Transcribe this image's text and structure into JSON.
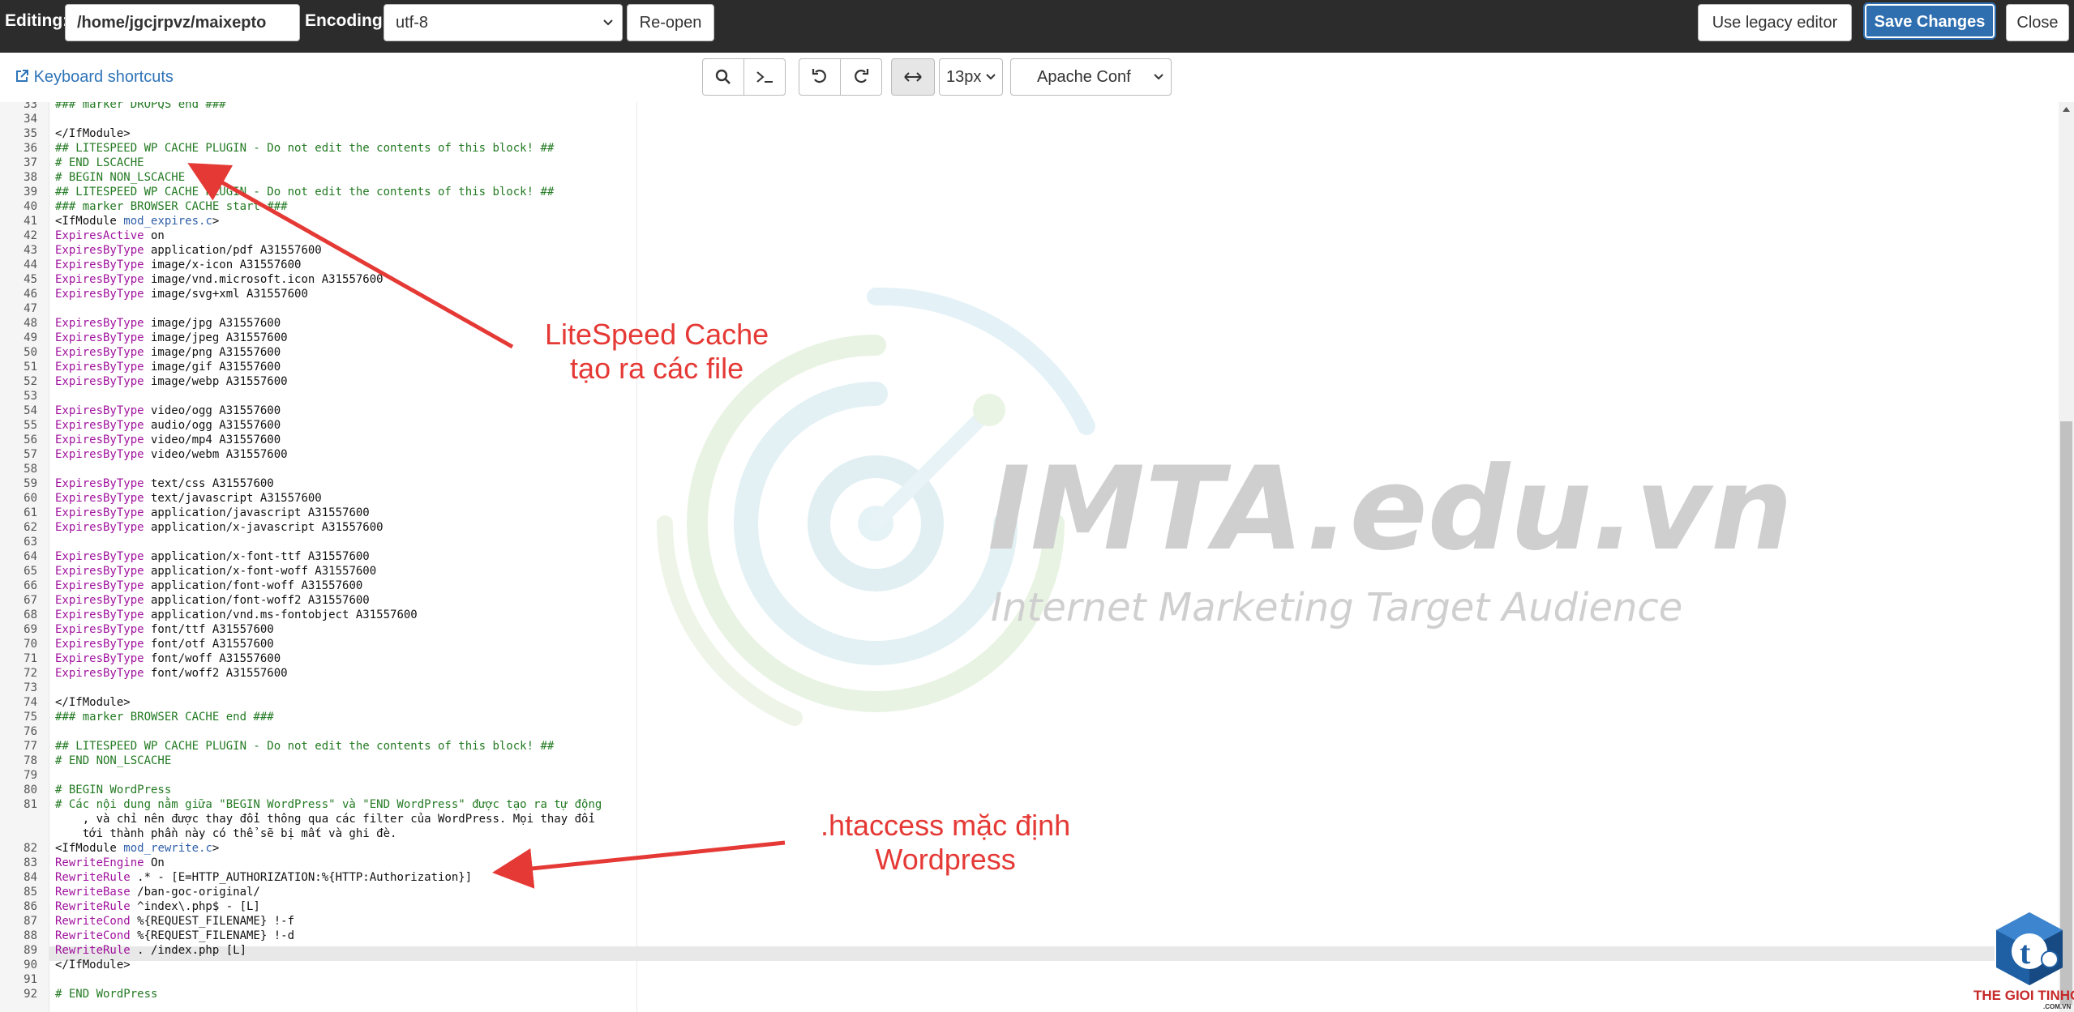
{
  "header": {
    "editing_label": "Editing:",
    "file_path": "/home/jgcjrpvz/maixepto",
    "encoding_label": "Encoding:",
    "encoding_value": "utf-8",
    "reopen_label": "Re-open",
    "legacy_label": "Use legacy editor",
    "save_label": "Save Changes",
    "close_label": "Close"
  },
  "toolbar": {
    "shortcuts_label": "Keyboard shortcuts",
    "font_size": "13px",
    "mode": "Apache Conf"
  },
  "icons": [
    "search-icon",
    "terminal-icon",
    "undo-icon",
    "redo-icon",
    "wrap-icon",
    "external-link-icon",
    "chevron-down-icon"
  ],
  "colors": {
    "accent": "#2f6fb0",
    "annotation": "#e53935",
    "comment": "#237a23",
    "keyword": "#a0129e",
    "module": "#2f5fa8"
  },
  "watermark": {
    "brand": "IMTA.edu.vn",
    "tagline": "Internet Marketing Target Audience"
  },
  "annotations": {
    "litespeed_line1": "LiteSpeed Cache",
    "litespeed_line2": "tạo ra các file",
    "htaccess_line1": ".htaccess mặc định",
    "htaccess_line2": "Wordpress"
  },
  "logo": {
    "brand": "THE GIOI TINHOC",
    "domain": ".COM.VN",
    "letter": "t"
  },
  "editor": {
    "active_line": "89",
    "lines": [
      {
        "n": "33",
        "t": "### marker DROPQS end ###"
      },
      {
        "n": "34",
        "t": ""
      },
      {
        "n": "35",
        "t": "</IfModule>"
      },
      {
        "n": "36",
        "t": "## LITESPEED WP CACHE PLUGIN - Do not edit the contents of this block! ##"
      },
      {
        "n": "37",
        "t": "# END LSCACHE"
      },
      {
        "n": "38",
        "t": "# BEGIN NON_LSCACHE"
      },
      {
        "n": "39",
        "t": "## LITESPEED WP CACHE PLUGIN - Do not edit the contents of this block! ##"
      },
      {
        "n": "40",
        "t": "### marker BROWSER CACHE start ###"
      },
      {
        "n": "41",
        "t": "<IfModule mod_expires.c>"
      },
      {
        "n": "42",
        "t": "ExpiresActive on"
      },
      {
        "n": "43",
        "t": "ExpiresByType application/pdf A31557600"
      },
      {
        "n": "44",
        "t": "ExpiresByType image/x-icon A31557600"
      },
      {
        "n": "45",
        "t": "ExpiresByType image/vnd.microsoft.icon A31557600"
      },
      {
        "n": "46",
        "t": "ExpiresByType image/svg+xml A31557600"
      },
      {
        "n": "47",
        "t": ""
      },
      {
        "n": "48",
        "t": "ExpiresByType image/jpg A31557600"
      },
      {
        "n": "49",
        "t": "ExpiresByType image/jpeg A31557600"
      },
      {
        "n": "50",
        "t": "ExpiresByType image/png A31557600"
      },
      {
        "n": "51",
        "t": "ExpiresByType image/gif A31557600"
      },
      {
        "n": "52",
        "t": "ExpiresByType image/webp A31557600"
      },
      {
        "n": "53",
        "t": ""
      },
      {
        "n": "54",
        "t": "ExpiresByType video/ogg A31557600"
      },
      {
        "n": "55",
        "t": "ExpiresByType audio/ogg A31557600"
      },
      {
        "n": "56",
        "t": "ExpiresByType video/mp4 A31557600"
      },
      {
        "n": "57",
        "t": "ExpiresByType video/webm A31557600"
      },
      {
        "n": "58",
        "t": ""
      },
      {
        "n": "59",
        "t": "ExpiresByType text/css A31557600"
      },
      {
        "n": "60",
        "t": "ExpiresByType text/javascript A31557600"
      },
      {
        "n": "61",
        "t": "ExpiresByType application/javascript A31557600"
      },
      {
        "n": "62",
        "t": "ExpiresByType application/x-javascript A31557600"
      },
      {
        "n": "63",
        "t": ""
      },
      {
        "n": "64",
        "t": "ExpiresByType application/x-font-ttf A31557600"
      },
      {
        "n": "65",
        "t": "ExpiresByType application/x-font-woff A31557600"
      },
      {
        "n": "66",
        "t": "ExpiresByType application/font-woff A31557600"
      },
      {
        "n": "67",
        "t": "ExpiresByType application/font-woff2 A31557600"
      },
      {
        "n": "68",
        "t": "ExpiresByType application/vnd.ms-fontobject A31557600"
      },
      {
        "n": "69",
        "t": "ExpiresByType font/ttf A31557600"
      },
      {
        "n": "70",
        "t": "ExpiresByType font/otf A31557600"
      },
      {
        "n": "71",
        "t": "ExpiresByType font/woff A31557600"
      },
      {
        "n": "72",
        "t": "ExpiresByType font/woff2 A31557600"
      },
      {
        "n": "73",
        "t": ""
      },
      {
        "n": "74",
        "t": "</IfModule>"
      },
      {
        "n": "75",
        "t": "### marker BROWSER CACHE end ###"
      },
      {
        "n": "76",
        "t": ""
      },
      {
        "n": "77",
        "t": "## LITESPEED WP CACHE PLUGIN - Do not edit the contents of this block! ##"
      },
      {
        "n": "78",
        "t": "# END NON_LSCACHE"
      },
      {
        "n": "79",
        "t": ""
      },
      {
        "n": "80",
        "t": "# BEGIN WordPress"
      },
      {
        "n": "81",
        "t": "# Các nội dung nằm giữa \"BEGIN WordPress\" và \"END WordPress\" được tạo ra tự động"
      },
      {
        "n": "",
        "t": "    , và chỉ nên được thay đổi thông qua các filter của WordPress. Mọi thay đổi"
      },
      {
        "n": "",
        "t": "    tới thành phần này có thể sẽ bị mất và ghi đè."
      },
      {
        "n": "82",
        "t": "<IfModule mod_rewrite.c>"
      },
      {
        "n": "83",
        "t": "RewriteEngine On"
      },
      {
        "n": "84",
        "t": "RewriteRule .* - [E=HTTP_AUTHORIZATION:%{HTTP:Authorization}]"
      },
      {
        "n": "85",
        "t": "RewriteBase /ban-goc-original/"
      },
      {
        "n": "86",
        "t": "RewriteRule ^index\\.php$ - [L]"
      },
      {
        "n": "87",
        "t": "RewriteCond %{REQUEST_FILENAME} !-f"
      },
      {
        "n": "88",
        "t": "RewriteCond %{REQUEST_FILENAME} !-d"
      },
      {
        "n": "89",
        "t": "RewriteRule . /index.php [L]"
      },
      {
        "n": "90",
        "t": "</IfModule>"
      },
      {
        "n": "91",
        "t": ""
      },
      {
        "n": "92",
        "t": "# END WordPress"
      }
    ]
  }
}
